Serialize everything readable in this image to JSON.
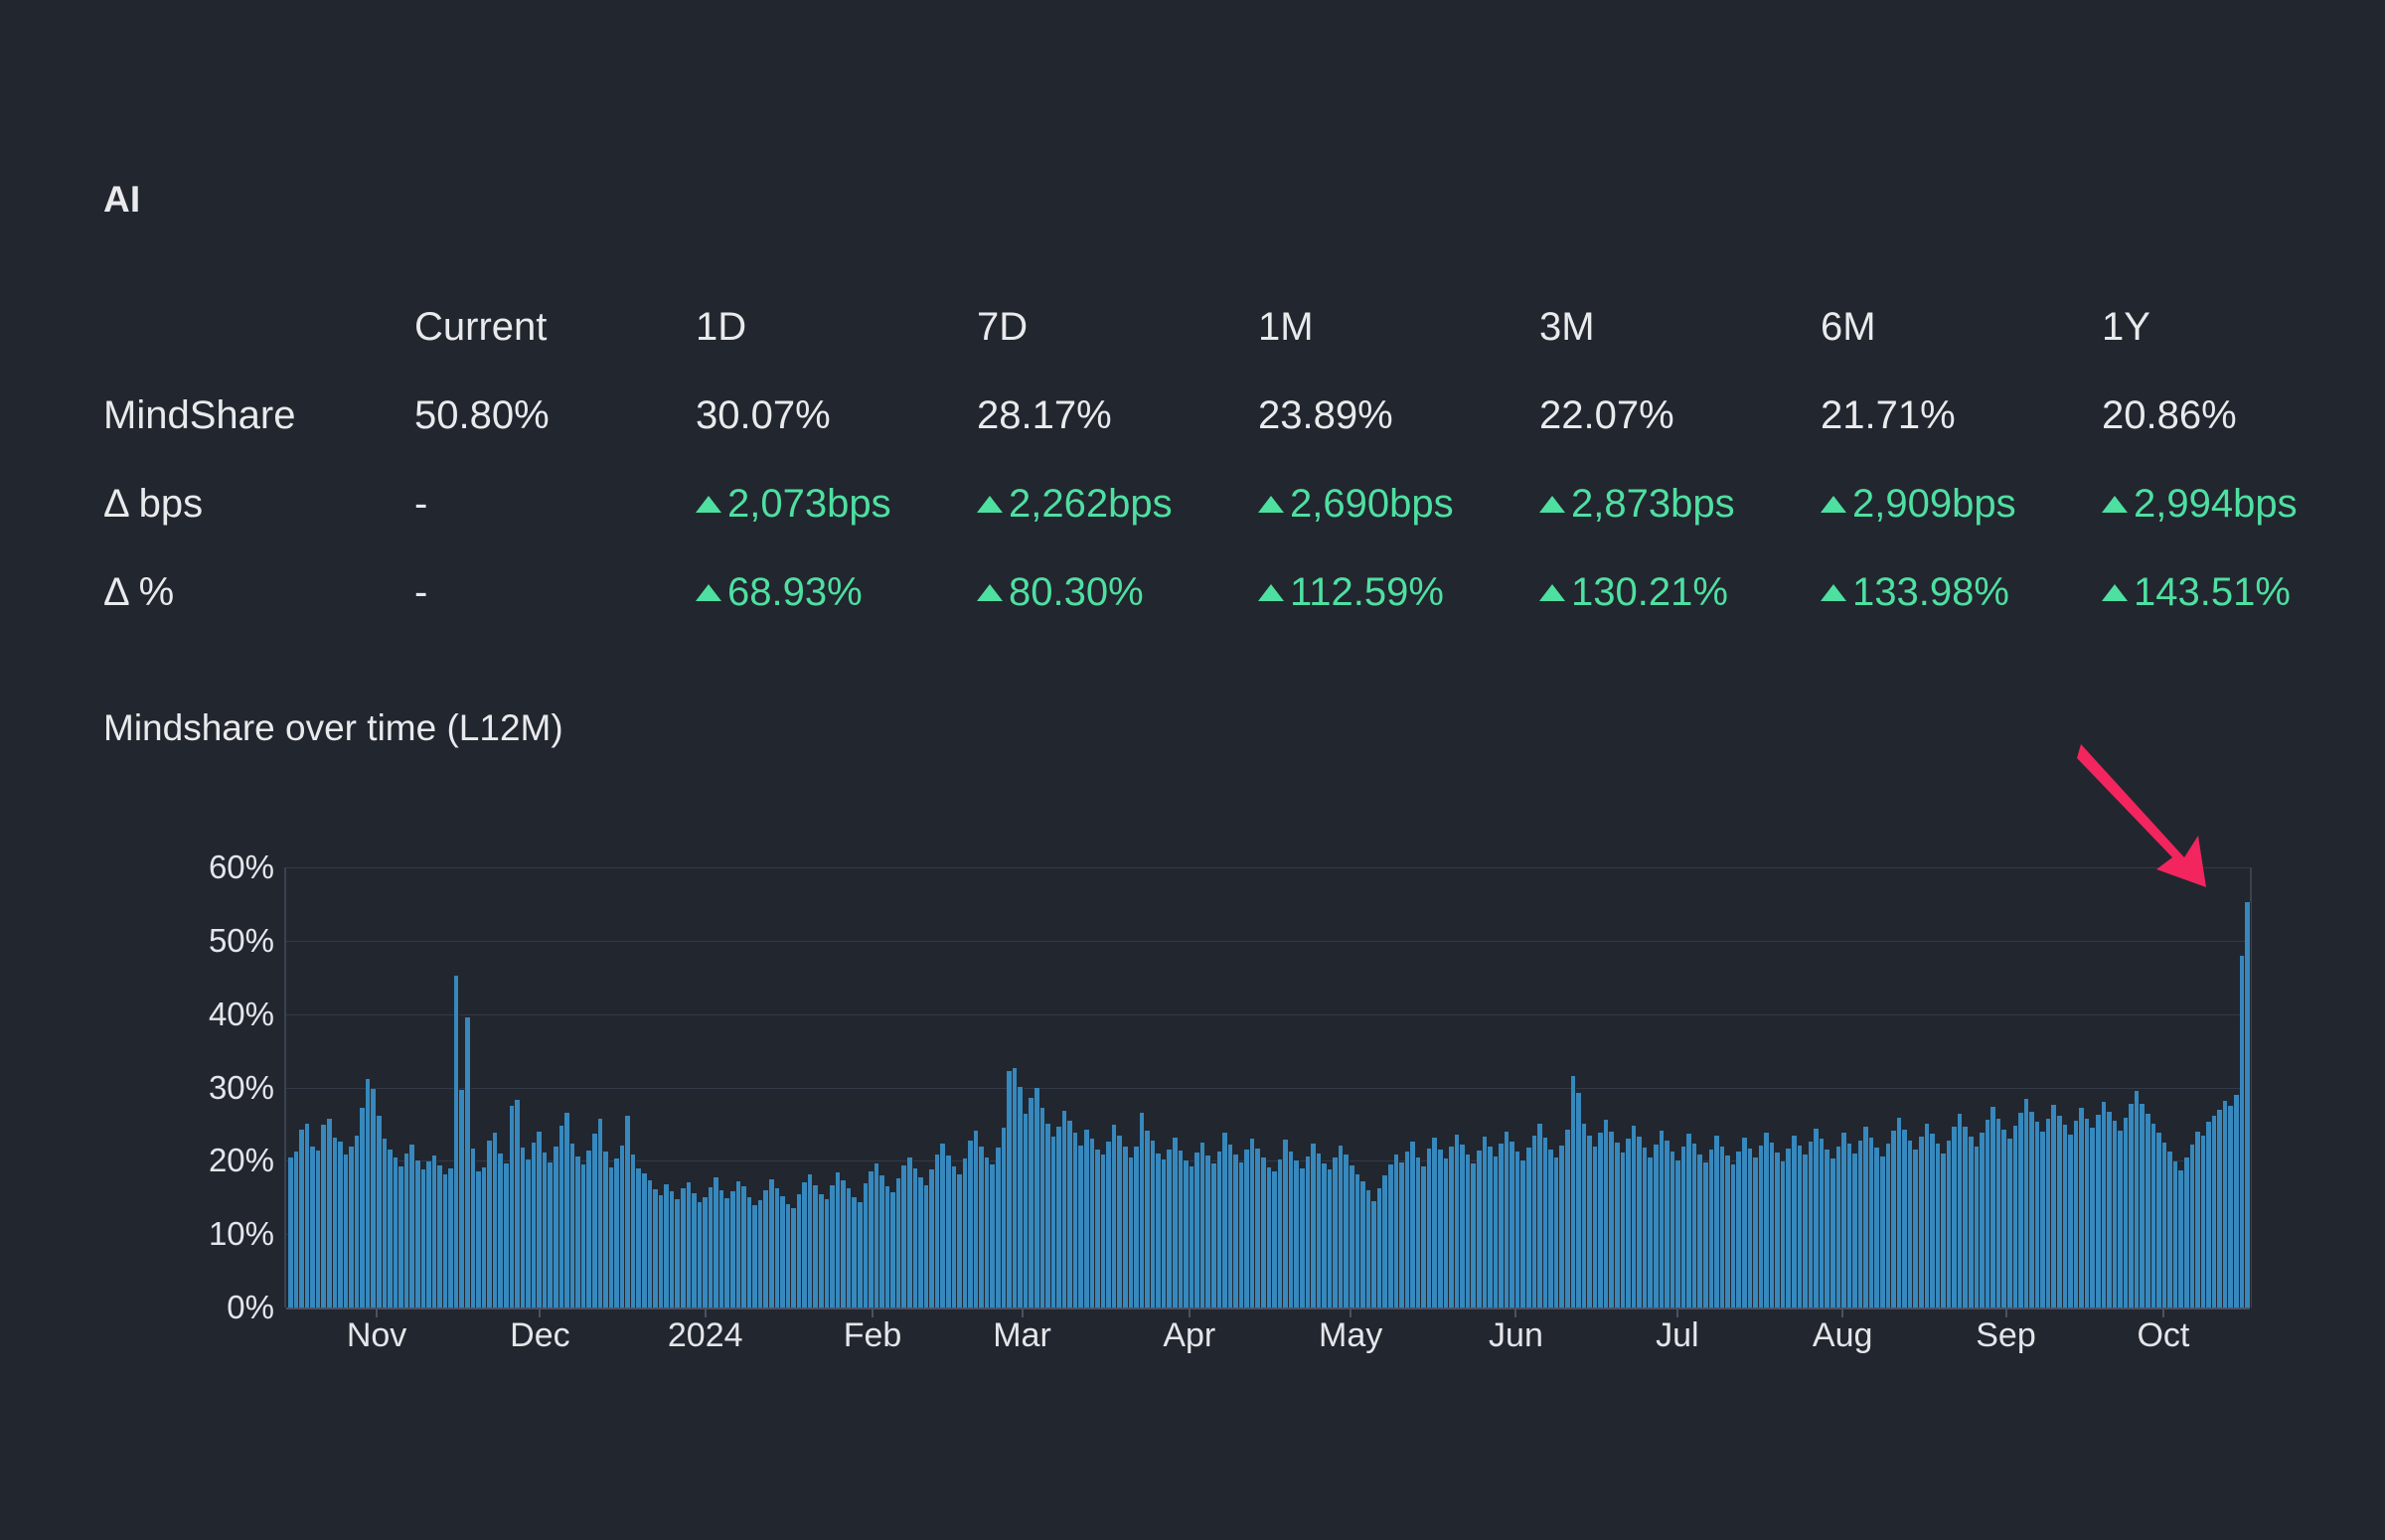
{
  "ticker": {
    "name": "AI"
  },
  "stats": {
    "column_headers": [
      "",
      "Current",
      "1D",
      "7D",
      "1M",
      "3M",
      "6M",
      "1Y"
    ],
    "rows": [
      {
        "label": "MindShare",
        "values": [
          "50.80%",
          "30.07%",
          "28.17%",
          "23.89%",
          "22.07%",
          "21.71%",
          "20.86%"
        ],
        "positive": [
          false,
          false,
          false,
          false,
          false,
          false,
          false
        ]
      },
      {
        "label": "Δ bps",
        "values": [
          "-",
          "2,073bps",
          "2,262bps",
          "2,690bps",
          "2,873bps",
          "2,909bps",
          "2,994bps"
        ],
        "positive": [
          false,
          true,
          true,
          true,
          true,
          true,
          true
        ]
      },
      {
        "label": "Δ %",
        "values": [
          "-",
          "68.93%",
          "80.30%",
          "112.59%",
          "130.21%",
          "133.98%",
          "143.51%"
        ],
        "positive": [
          false,
          true,
          true,
          true,
          true,
          true,
          true
        ]
      }
    ]
  },
  "chart_section": {
    "title": "Mindshare over time (L12M)"
  },
  "annotation": {
    "arrow_color": "#f2255e",
    "points_at": "final-bar-spike"
  },
  "colors": {
    "background": "#22262f",
    "bar": "#3688bd",
    "positive": "#4ee0a1",
    "text": "#e9eaec",
    "grid": "#333a47"
  },
  "chart_data": {
    "type": "bar",
    "title": "Mindshare over time (L12M)",
    "xlabel": "",
    "ylabel": "",
    "ylim": [
      0,
      60
    ],
    "ytick_labels": [
      "60%",
      "50%",
      "40%",
      "30%",
      "20%",
      "10%",
      "0%"
    ],
    "ytick_values": [
      60,
      50,
      40,
      30,
      20,
      10,
      0
    ],
    "grid": true,
    "legend": false,
    "xtick_labels": [
      "Nov",
      "Dec",
      "2024",
      "Feb",
      "Mar",
      "Apr",
      "May",
      "Jun",
      "Jul",
      "Aug",
      "Sep",
      "Oct"
    ],
    "xtick_positions_pct": [
      4.7,
      13.0,
      21.4,
      29.9,
      37.5,
      46.0,
      54.2,
      62.6,
      70.8,
      79.2,
      87.5,
      95.5
    ],
    "series_name": "MindShare",
    "unit": "%",
    "values": [
      20.5,
      21.2,
      24.3,
      25.1,
      22.0,
      21.4,
      24.9,
      25.8,
      23.1,
      22.6,
      20.8,
      21.9,
      23.4,
      27.2,
      31.2,
      29.8,
      26.2,
      23.0,
      21.6,
      20.4,
      19.3,
      21.0,
      22.2,
      20.1,
      18.8,
      19.9,
      20.7,
      19.4,
      18.2,
      18.9,
      45.2,
      29.6,
      39.5,
      21.7,
      18.5,
      19.1,
      22.8,
      23.9,
      21.0,
      19.6,
      27.5,
      28.3,
      21.8,
      20.2,
      22.5,
      24.0,
      21.1,
      19.8,
      22.0,
      24.8,
      26.6,
      22.3,
      20.6,
      19.5,
      21.4,
      23.7,
      25.7,
      21.2,
      19.1,
      20.3,
      22.1,
      26.2,
      20.9,
      19.0,
      18.3,
      17.4,
      16.1,
      15.3,
      16.8,
      15.9,
      14.8,
      16.2,
      17.1,
      15.6,
      14.3,
      15.1,
      16.4,
      17.8,
      16.0,
      14.9,
      15.8,
      17.2,
      16.5,
      15.0,
      13.9,
      14.6,
      16.0,
      17.5,
      16.3,
      15.2,
      14.1,
      13.6,
      15.4,
      17.0,
      18.1,
      16.7,
      15.5,
      14.7,
      16.6,
      18.4,
      17.3,
      16.2,
      15.1,
      14.4,
      16.9,
      18.6,
      19.7,
      18.0,
      16.5,
      15.7,
      17.6,
      19.4,
      20.5,
      19.0,
      17.8,
      16.6,
      18.8,
      20.9,
      22.4,
      20.7,
      19.2,
      18.1,
      20.3,
      22.8,
      24.1,
      22.0,
      20.4,
      19.5,
      21.8,
      24.5,
      32.3,
      32.7,
      30.1,
      26.4,
      28.6,
      29.9,
      27.2,
      25.0,
      23.3,
      24.7,
      26.8,
      25.4,
      23.9,
      22.1,
      24.2,
      23.0,
      21.5,
      20.8,
      22.6,
      24.9,
      23.4,
      21.9,
      20.5,
      22.0,
      26.5,
      24.1,
      22.7,
      21.0,
      20.2,
      21.6,
      23.2,
      21.4,
      20.0,
      19.3,
      21.1,
      22.5,
      20.7,
      19.6,
      21.3,
      23.8,
      22.2,
      20.9,
      19.8,
      21.5,
      23.0,
      21.7,
      20.4,
      19.1,
      18.5,
      20.2,
      22.9,
      21.3,
      20.0,
      18.9,
      20.6,
      22.4,
      21.0,
      19.7,
      18.8,
      20.5,
      22.1,
      20.8,
      19.4,
      18.1,
      17.2,
      16.0,
      14.5,
      16.3,
      18.0,
      19.5,
      20.9,
      19.8,
      21.2,
      22.6,
      20.4,
      19.2,
      21.7,
      23.1,
      21.5,
      20.3,
      22.0,
      23.6,
      22.2,
      20.8,
      19.6,
      21.4,
      23.3,
      21.9,
      20.6,
      22.3,
      24.0,
      22.6,
      21.2,
      20.0,
      21.8,
      23.5,
      25.0,
      23.2,
      21.6,
      20.4,
      22.1,
      24.3,
      31.6,
      29.2,
      25.1,
      23.4,
      21.9,
      23.8,
      25.6,
      24.0,
      22.5,
      21.1,
      23.0,
      24.8,
      23.3,
      21.8,
      20.5,
      22.2,
      24.1,
      22.7,
      21.3,
      20.1,
      21.9,
      23.7,
      22.3,
      20.9,
      19.8,
      21.6,
      23.4,
      22.0,
      20.7,
      19.5,
      21.3,
      23.1,
      21.7,
      20.4,
      22.1,
      23.9,
      22.5,
      21.1,
      19.9,
      21.7,
      23.5,
      22.1,
      20.8,
      22.6,
      24.4,
      23.0,
      21.6,
      20.3,
      22.0,
      23.8,
      22.4,
      21.0,
      22.8,
      24.6,
      23.2,
      21.8,
      20.6,
      22.3,
      24.1,
      25.9,
      24.2,
      22.8,
      21.5,
      23.3,
      25.1,
      23.7,
      22.3,
      21.0,
      22.8,
      24.6,
      26.4,
      24.7,
      23.3,
      22.0,
      23.8,
      25.6,
      27.4,
      25.7,
      24.3,
      23.0,
      24.8,
      26.6,
      28.4,
      26.7,
      25.3,
      24.0,
      25.8,
      27.6,
      26.2,
      24.9,
      23.6,
      25.4,
      27.2,
      25.8,
      24.5,
      26.3,
      28.1,
      26.7,
      25.4,
      24.1,
      25.9,
      27.7,
      29.5,
      27.8,
      26.4,
      25.1,
      23.8,
      22.5,
      21.2,
      19.9,
      18.7,
      20.4,
      22.2,
      24.0,
      23.5,
      25.3,
      26.1,
      27.0,
      28.2,
      27.5,
      29.0,
      48.0,
      55.3
    ]
  }
}
